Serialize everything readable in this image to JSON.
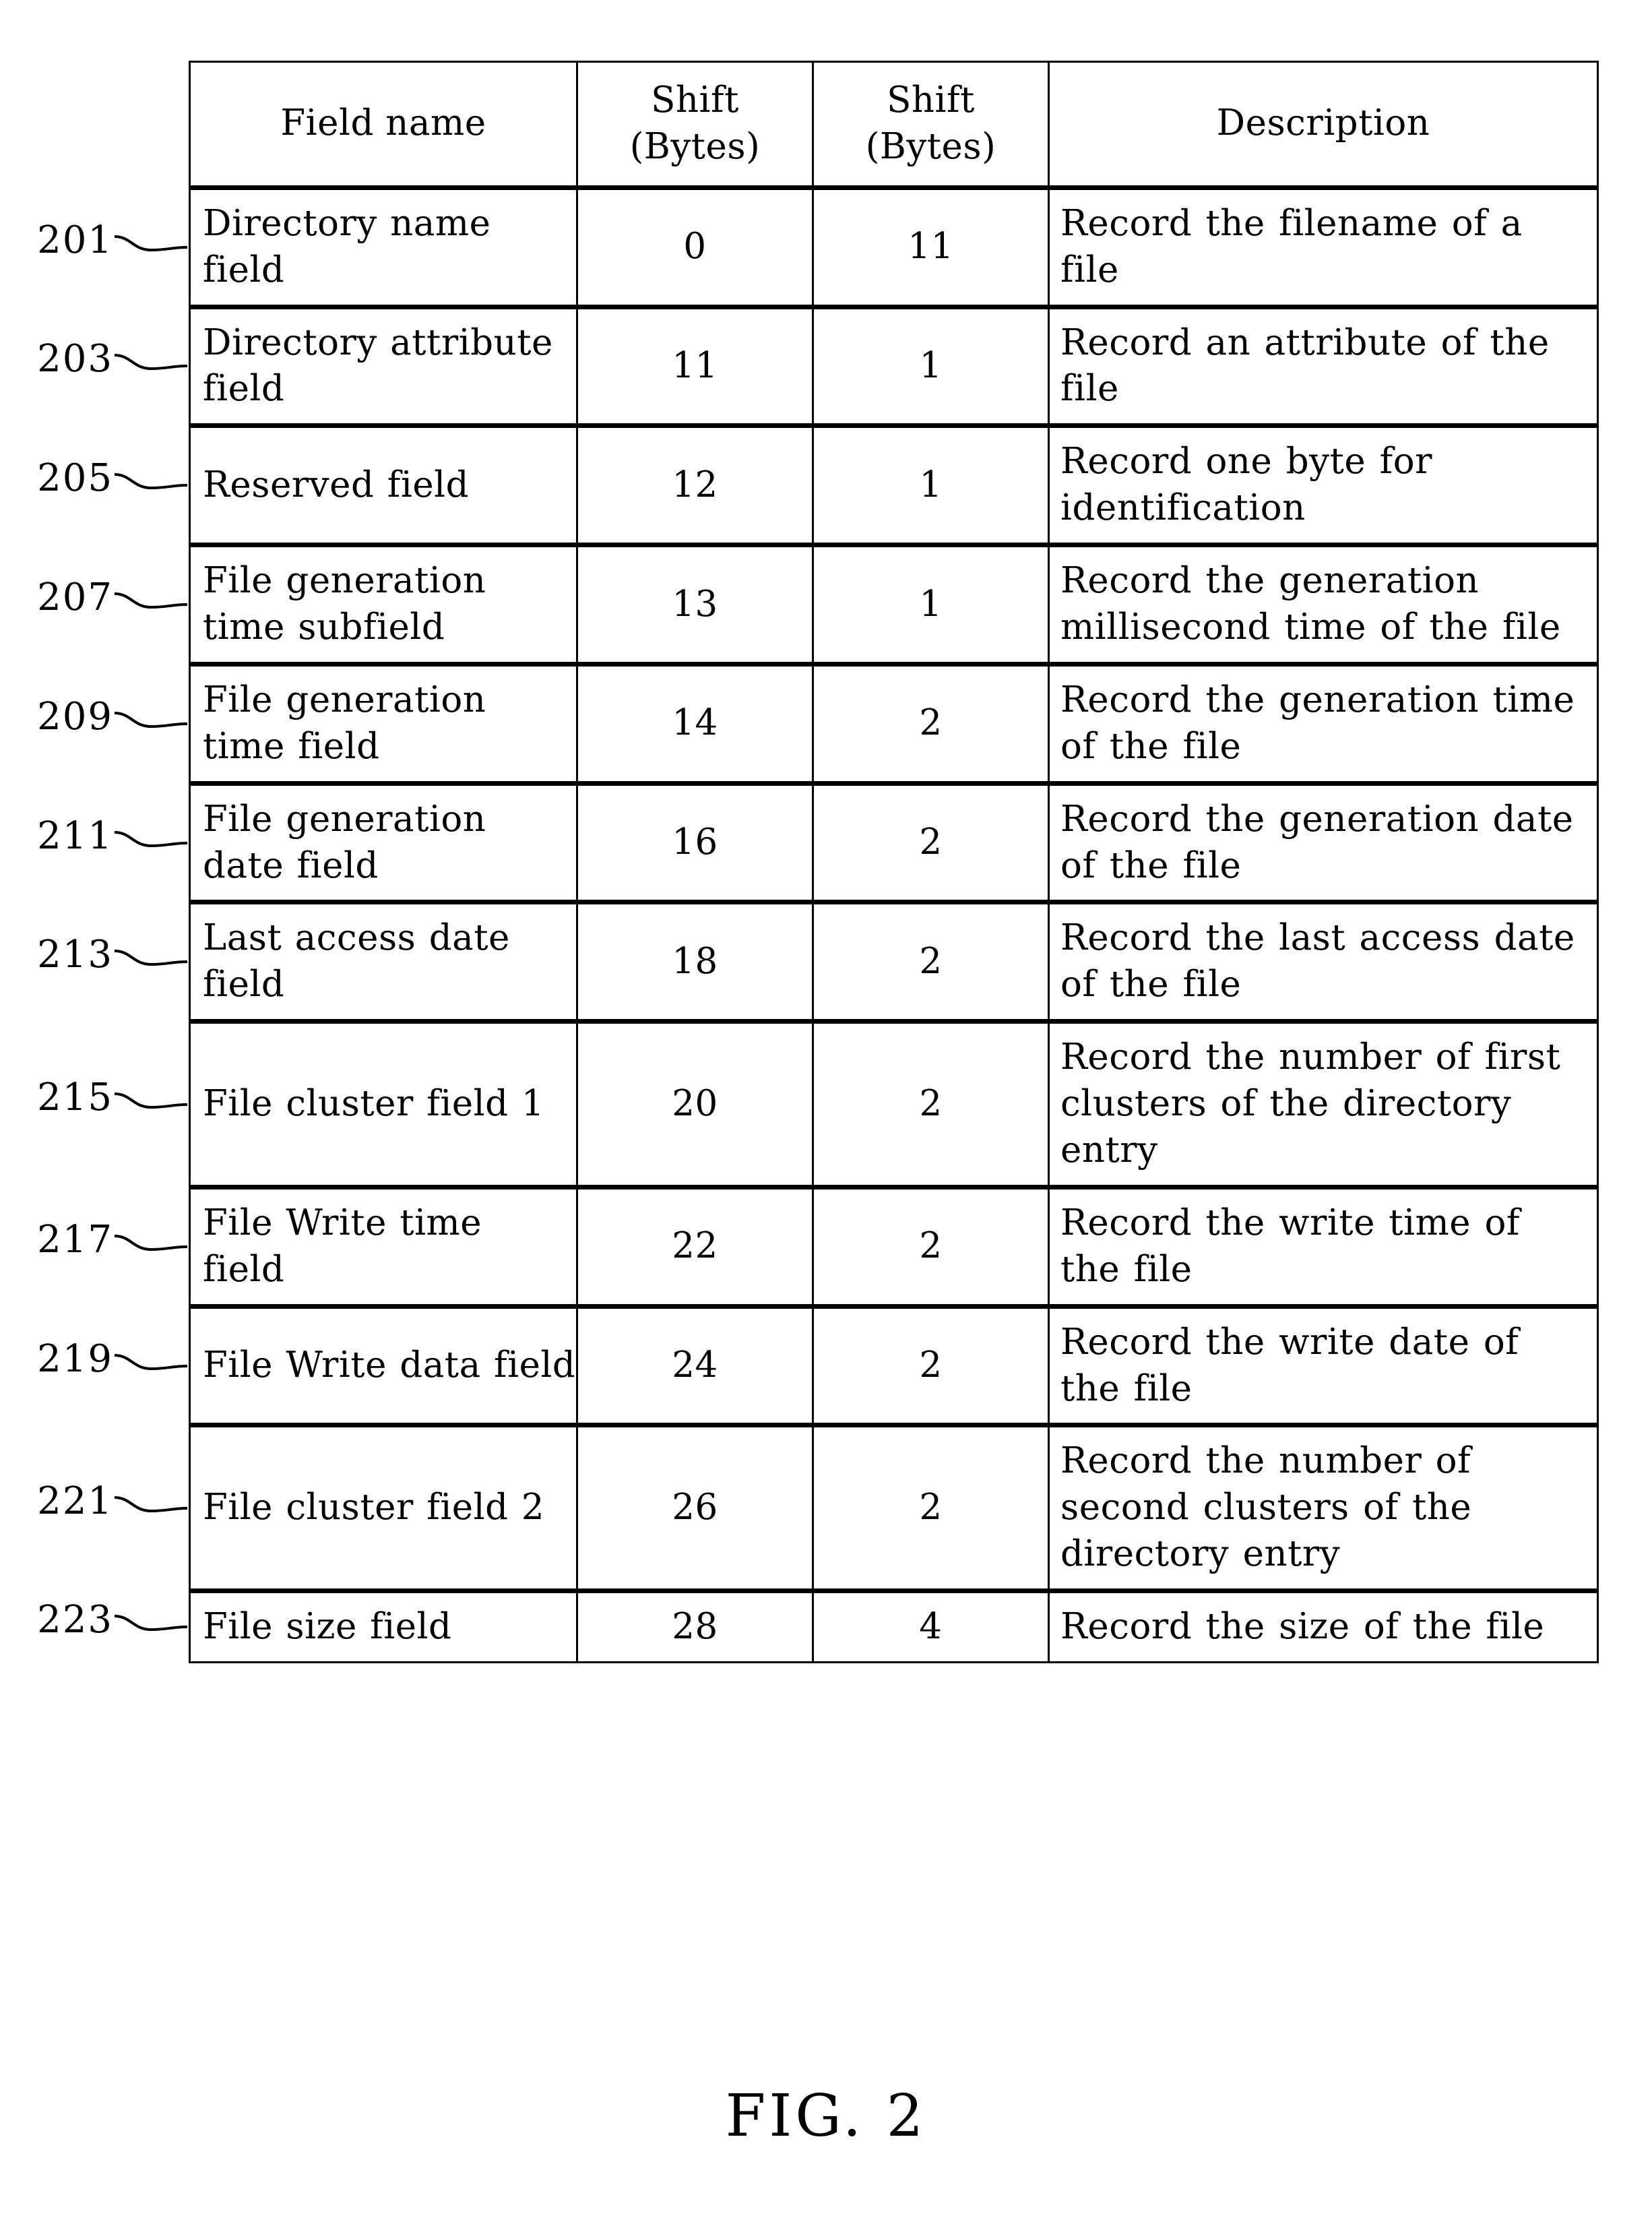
{
  "figure": {
    "caption": "FIG. 2"
  },
  "table": {
    "headers": {
      "field_name": "Field name",
      "shift_1_line1": "Shift",
      "shift_1_line2": "(Bytes)",
      "shift_2_line1": "Shift",
      "shift_2_line2": "(Bytes)",
      "description": "Description"
    },
    "rows": [
      {
        "ref": "201",
        "field_name": "Directory name field",
        "offset": "0",
        "length": "11",
        "description": "Record the filename of a file"
      },
      {
        "ref": "203",
        "field_name": "Directory attribute field",
        "offset": "11",
        "length": "1",
        "description": "Record an attribute of the file"
      },
      {
        "ref": "205",
        "field_name": "Reserved field",
        "offset": "12",
        "length": "1",
        "description": "Record one byte for identification"
      },
      {
        "ref": "207",
        "field_name": "File generation time subfield",
        "offset": "13",
        "length": "1",
        "description": "Record the generation millisecond time of the file"
      },
      {
        "ref": "209",
        "field_name": "File generation time field",
        "offset": "14",
        "length": "2",
        "description": "Record the generation time of the file"
      },
      {
        "ref": "211",
        "field_name": "File generation date field",
        "offset": "16",
        "length": "2",
        "description": "Record the generation date of the file"
      },
      {
        "ref": "213",
        "field_name": "Last access date field",
        "offset": "18",
        "length": "2",
        "description": "Record the last access date of the file"
      },
      {
        "ref": "215",
        "field_name": "File cluster field 1",
        "offset": "20",
        "length": "2",
        "description": "Record the number of first clusters of the directory entry"
      },
      {
        "ref": "217",
        "field_name": "File Write time field",
        "offset": "22",
        "length": "2",
        "description": "Record the write time of the file"
      },
      {
        "ref": "219",
        "field_name": "File Write data field",
        "offset": "24",
        "length": "2",
        "description": "Record the write date of the file"
      },
      {
        "ref": "221",
        "field_name": "File cluster field 2",
        "offset": "26",
        "length": "2",
        "description": "Record the number of second clusters of the directory entry"
      },
      {
        "ref": "223",
        "field_name": "File size field",
        "offset": "28",
        "length": "4",
        "description": "Record the size of the file"
      }
    ]
  },
  "style": {
    "ink_color": "#000000",
    "paper_color": "#ffffff"
  }
}
